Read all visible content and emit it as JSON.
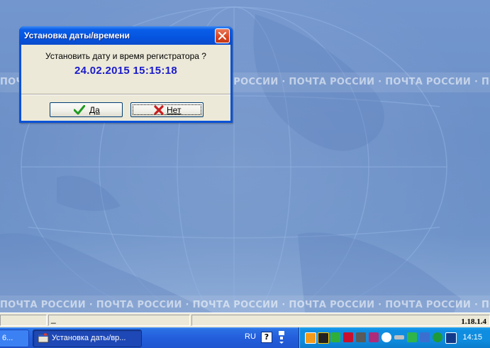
{
  "desktop": {
    "band_text": "ПОЧТА РОССИИ · ПОЧТА РОССИИ · ПОЧТА РОССИИ · ПОЧТА РОССИИ · ПОЧТА РОССИИ · ПОЧТА РОССИИ · ПОЧТА РОССИИ · ПОЧТА РОССИИ"
  },
  "dialog": {
    "title": "Установка даты/времени",
    "question": "Установить дату и время регистратора ?",
    "datetime": "24.02.2015 15:15:18",
    "yes_label": "Да",
    "no_label": "Нет"
  },
  "statusbar": {
    "caret": "_",
    "version": "1.18.1.4"
  },
  "taskbar": {
    "task1_label": "6...",
    "task2_label": "Установка даты/вр...",
    "lang": "RU",
    "help": "?",
    "clock": "14:15"
  },
  "colors": {
    "accent": "#0a52d6",
    "datetime": "#1a1acc"
  }
}
